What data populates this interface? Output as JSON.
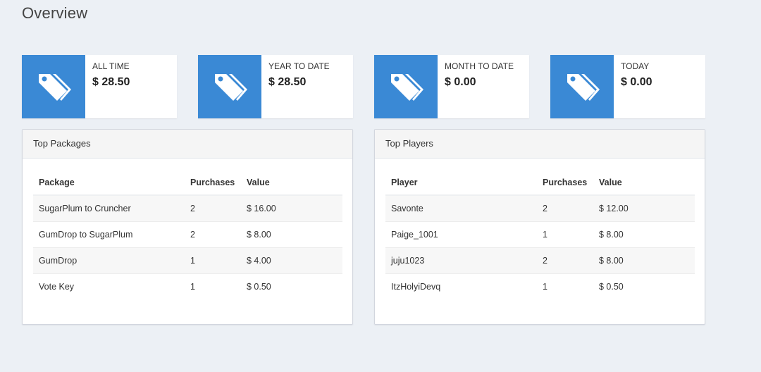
{
  "page": {
    "title": "Overview"
  },
  "colors": {
    "accent": "#3a89d5",
    "background": "#ecf0f5"
  },
  "stats": [
    {
      "icon": "tags-icon",
      "label": "ALL TIME",
      "value": "$ 28.50"
    },
    {
      "icon": "tags-icon",
      "label": "YEAR TO DATE",
      "value": "$ 28.50"
    },
    {
      "icon": "tags-icon",
      "label": "MONTH TO DATE",
      "value": "$ 0.00"
    },
    {
      "icon": "tags-icon",
      "label": "TODAY",
      "value": "$ 0.00"
    }
  ],
  "top_packages": {
    "title": "Top Packages",
    "columns": [
      "Package",
      "Purchases",
      "Value"
    ],
    "rows": [
      [
        "SugarPlum to Cruncher",
        "2",
        "$ 16.00"
      ],
      [
        "GumDrop to SugarPlum",
        "2",
        "$ 8.00"
      ],
      [
        "GumDrop",
        "1",
        "$ 4.00"
      ],
      [
        "Vote Key",
        "1",
        "$ 0.50"
      ]
    ]
  },
  "top_players": {
    "title": "Top Players",
    "columns": [
      "Player",
      "Purchases",
      "Value"
    ],
    "rows": [
      [
        "Savonte",
        "2",
        "$ 12.00"
      ],
      [
        "Paige_1001",
        "1",
        "$ 8.00"
      ],
      [
        "juju1023",
        "2",
        "$ 8.00"
      ],
      [
        "ItzHolyiDevq",
        "1",
        "$ 0.50"
      ]
    ]
  }
}
